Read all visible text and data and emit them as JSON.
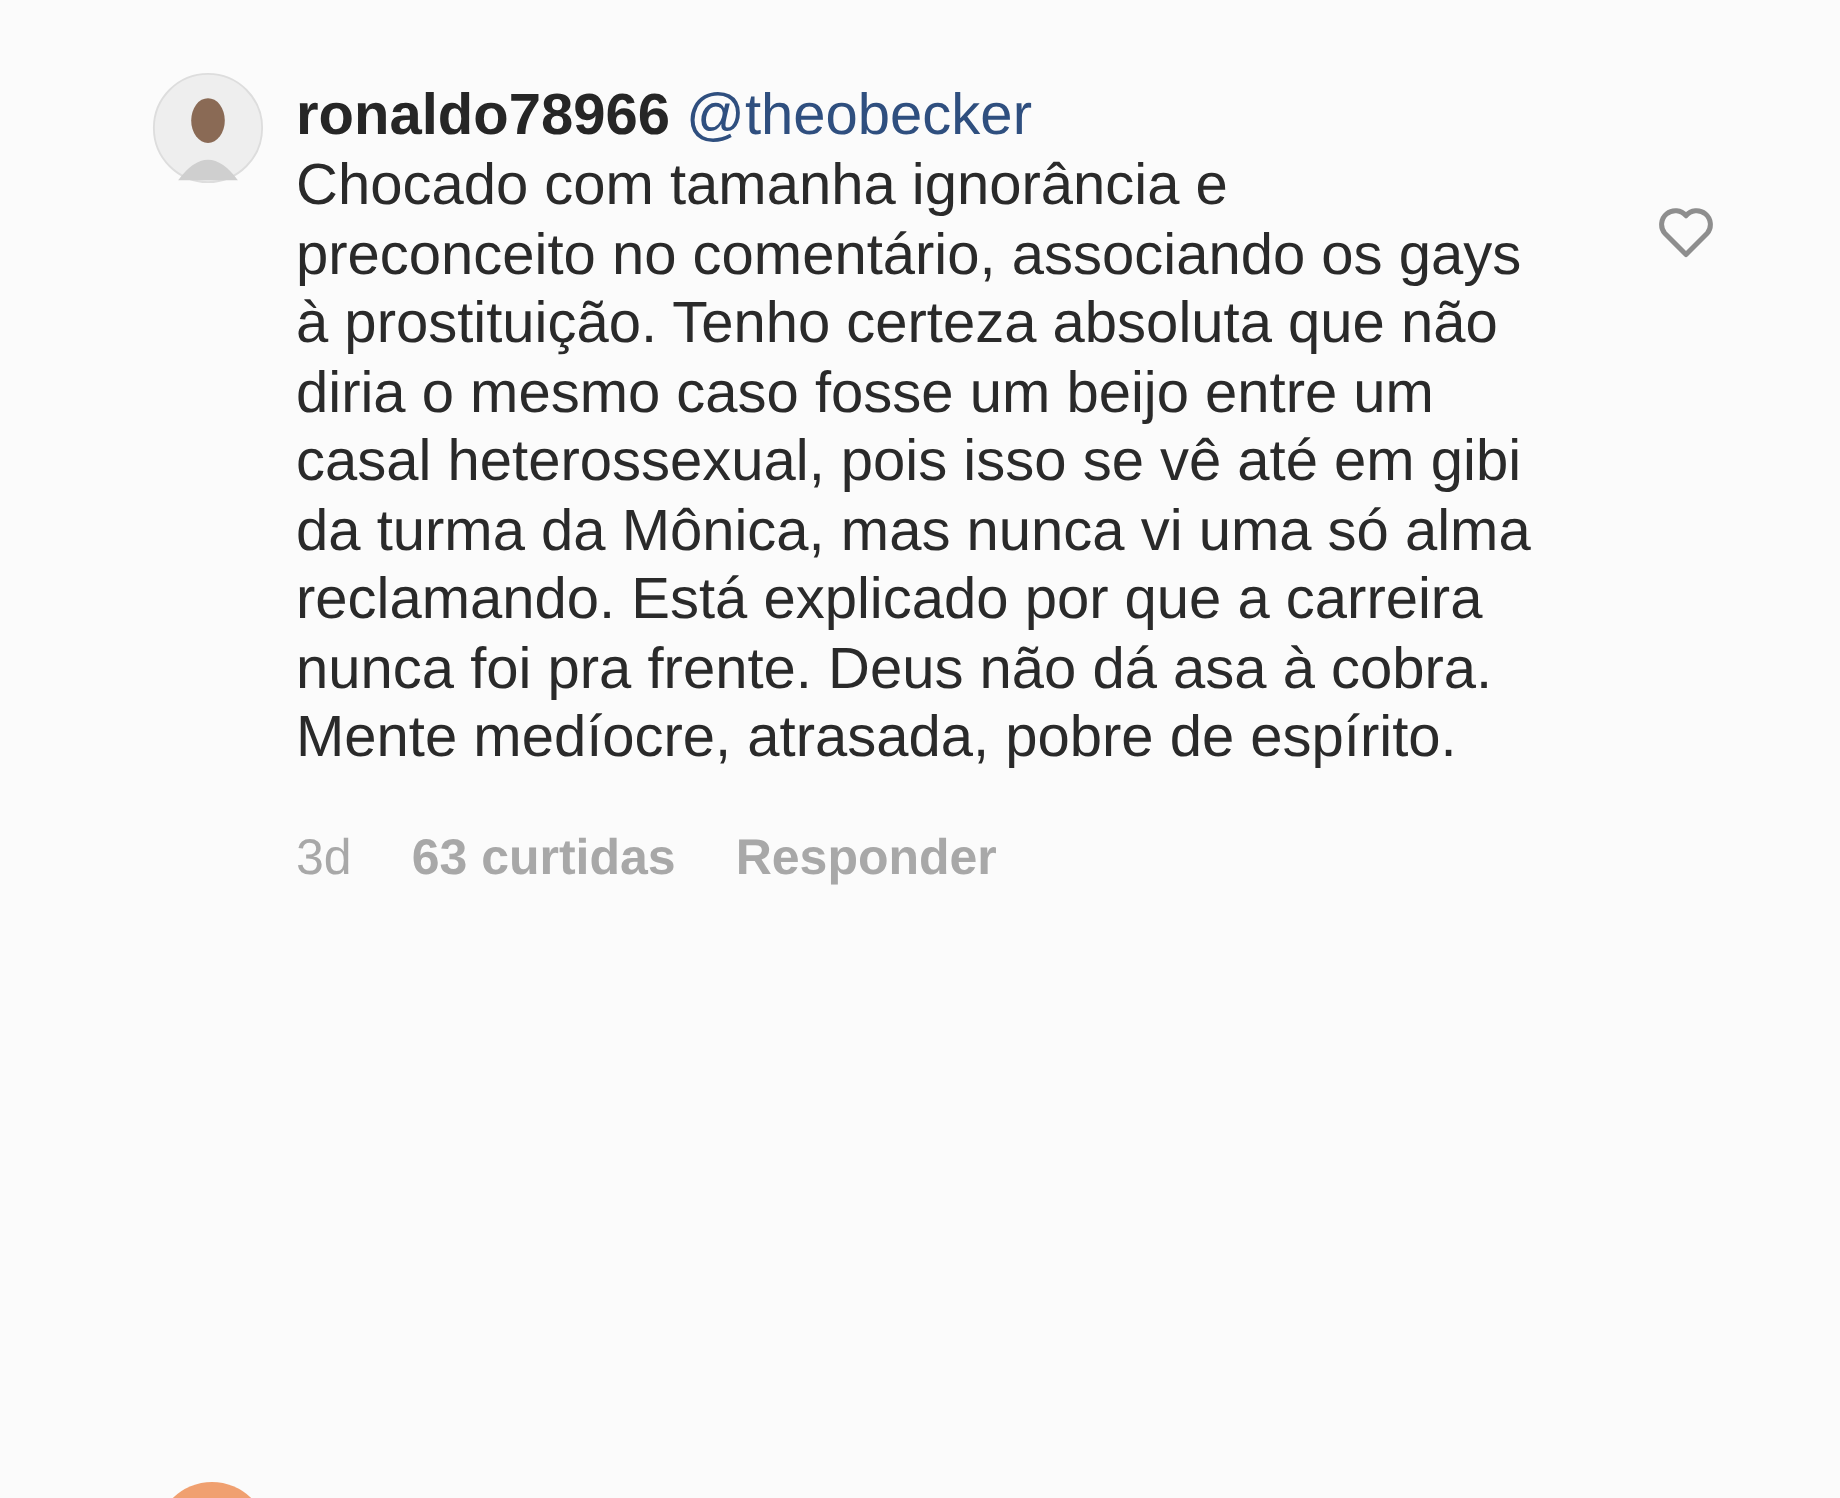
{
  "comment": {
    "username": "ronaldo78966",
    "mention": "@theobecker",
    "text": "Chocado com tamanha ignorância e preconceito no comentário, associando os gays à prostituição. Tenho certeza absoluta que não diria o mesmo caso fosse um beijo entre um casal heterossexual, pois isso se vê até em gibi da turma da Mônica, mas nunca vi uma só alma reclamando. Está explicado por que a carreira nunca foi pra frente. Deus não dá asa à cobra. Mente medíocre, atrasada, pobre de espírito.",
    "liked": false,
    "time": "3d",
    "likes": "63 curtidas",
    "reply": "Responder"
  }
}
